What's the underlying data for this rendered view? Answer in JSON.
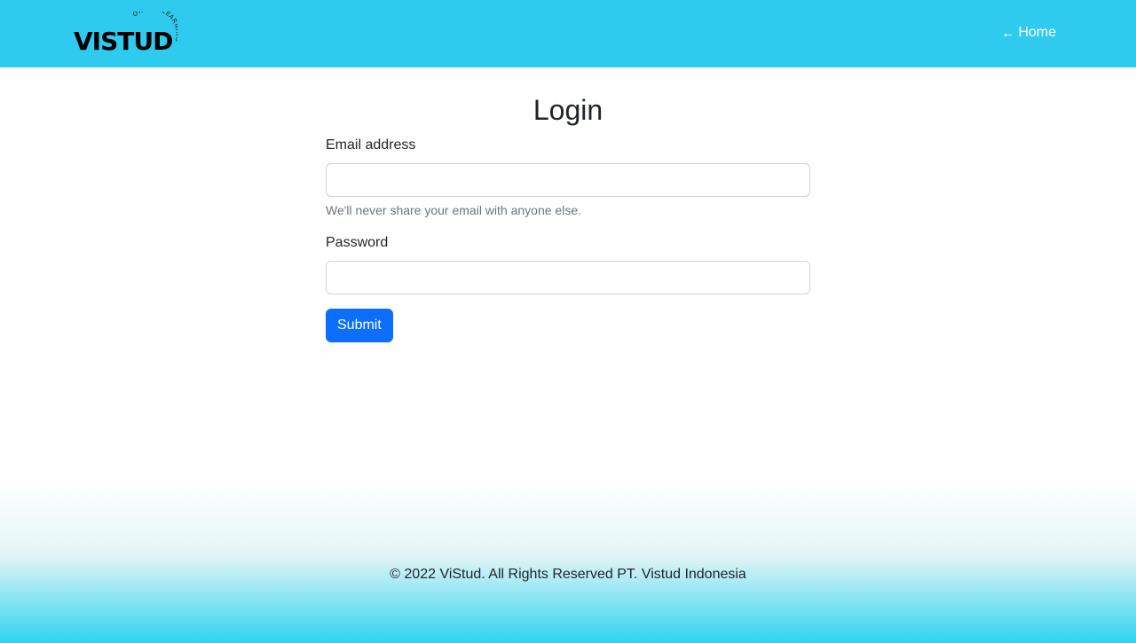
{
  "navbar": {
    "brand": "VISTUD",
    "tagline": "ONLINE LEARNING",
    "home_arrow_icon": "arrow-left-icon",
    "home_label": "Home",
    "background": "#2fcbef"
  },
  "form": {
    "title": "Login",
    "email_label": "Email address",
    "email_value": "",
    "email_help": "We'll never share your email with anyone else.",
    "password_label": "Password",
    "password_value": "",
    "submit_label": "Submit",
    "submit_color": "#0d6efd"
  },
  "footer": {
    "copyright": "© 2022 ViStud. All Rights Reserved PT. Vistud Indonesia"
  }
}
